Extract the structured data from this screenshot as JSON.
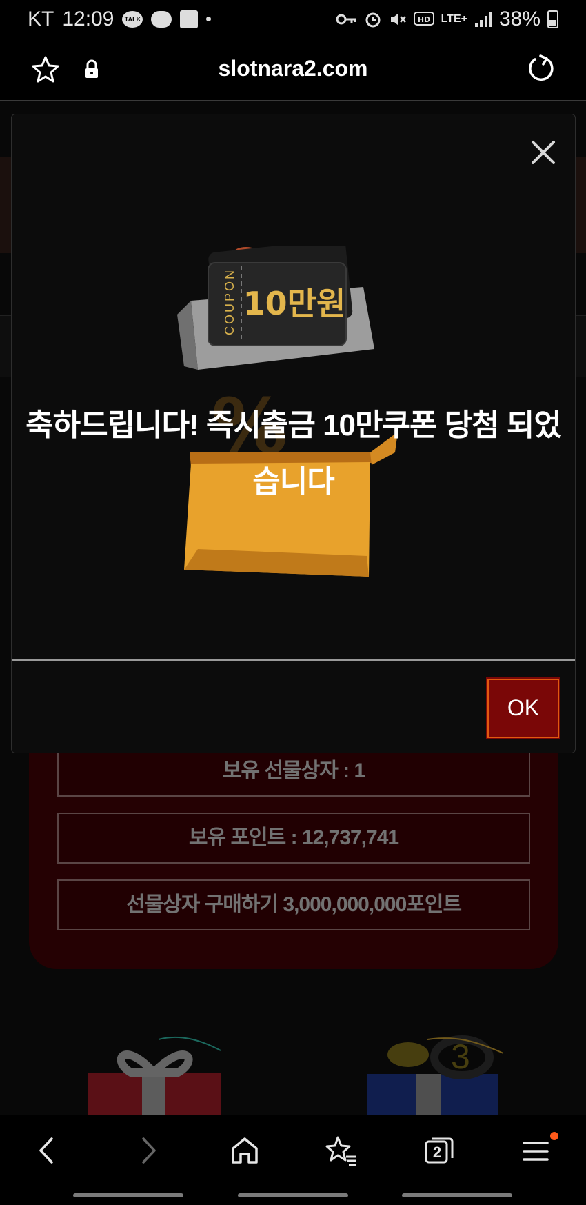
{
  "status_bar": {
    "carrier": "KT",
    "time": "12:09",
    "talk_label": "TALK",
    "battery": "38%",
    "network": "LTE+"
  },
  "browser": {
    "url": "slotnara2.com"
  },
  "background_page": {
    "gift_boxes_owned": "보유 선물상자 : 1",
    "points_owned": "보유 포인트 : 12,737,741",
    "buy_gift_box": "선물상자 구매하기 3,000,000,000포인트",
    "gift_badge_number": "3"
  },
  "modal": {
    "coupon_label": "COUPON",
    "coupon_value": "10만원",
    "message": "축하드립니다! 즉시출금 10만쿠폰 당첨 되었습니다",
    "ok_label": "OK"
  },
  "nav": {
    "tab_count": "2"
  },
  "colors": {
    "modal_bg": "#0c0c0c",
    "panel_bg": "#3a0205",
    "ok_button": "#7a0707",
    "coupon_gold": "#e0b34a",
    "box_orange": "#e8a22c"
  }
}
